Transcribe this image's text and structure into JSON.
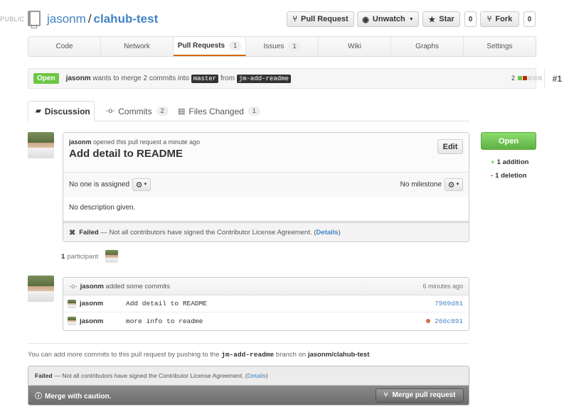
{
  "header": {
    "visibility": "PUBLIC",
    "owner": "jasonm",
    "separator": "/",
    "repo": "clahub-test",
    "buttons": {
      "pull_request": "Pull Request",
      "unwatch": "Unwatch",
      "star": "Star",
      "star_count": "0",
      "fork": "Fork",
      "fork_count": "0"
    }
  },
  "repo_tabs": [
    {
      "label": "Code"
    },
    {
      "label": "Network"
    },
    {
      "label": "Pull Requests",
      "count": "1"
    },
    {
      "label": "Issues",
      "count": "1"
    },
    {
      "label": "Wiki"
    },
    {
      "label": "Graphs"
    },
    {
      "label": "Settings"
    }
  ],
  "pr": {
    "state": "Open",
    "author": "jasonm",
    "text_wants": "wants to merge 2 commits into",
    "base_branch": "master",
    "text_from": "from",
    "head_branch": "jm-add-readme",
    "diffstat_count": "2",
    "number": "#1"
  },
  "sub_tabs": {
    "discussion": "Discussion",
    "commits": "Commits",
    "commits_count": "2",
    "files": "Files Changed",
    "files_count": "1"
  },
  "discussion": {
    "author": "jasonm",
    "opened_text": "opened this pull request a minute ago",
    "title": "Add detail to README",
    "edit_label": "Edit",
    "assignee": "No one is assigned",
    "milestone": "No milestone",
    "description": "No description given.",
    "fail_label": "Failed",
    "fail_text": "— Not all contributors have signed the Contributor License Agreement. (",
    "details_link": "Details",
    "fail_end": ")"
  },
  "participants": {
    "count": "1",
    "label": "participant"
  },
  "commits_block": {
    "author": "jasonm",
    "header_text": "added some commits",
    "time": "6 minutes ago",
    "rows": [
      {
        "author": "jasonm",
        "message": "Add detail to README",
        "sha": "7969d81"
      },
      {
        "author": "jasonm",
        "message": "more info to readme",
        "sha": "266c891"
      }
    ]
  },
  "merge": {
    "hint_prefix": "You can add more commits to this pull request by pushing to the",
    "hint_branch": "jm-add-readme",
    "hint_mid": "branch on",
    "hint_repo": "jasonm/clahub-test",
    "fail_label": "Failed",
    "fail_text": "— Not all contributors have signed the Contributor License Agreement. (",
    "details_link": "Details",
    "fail_end": ")",
    "caution": "Merge with caution.",
    "merge_button": "Merge pull request"
  },
  "sidebar": {
    "state_button": "Open",
    "additions": "1 addition",
    "deletions": "1 deletion"
  },
  "colors": {
    "accent_link": "#4183c4",
    "open_green": "#6cc644",
    "tab_active_underline": "#d26911"
  }
}
